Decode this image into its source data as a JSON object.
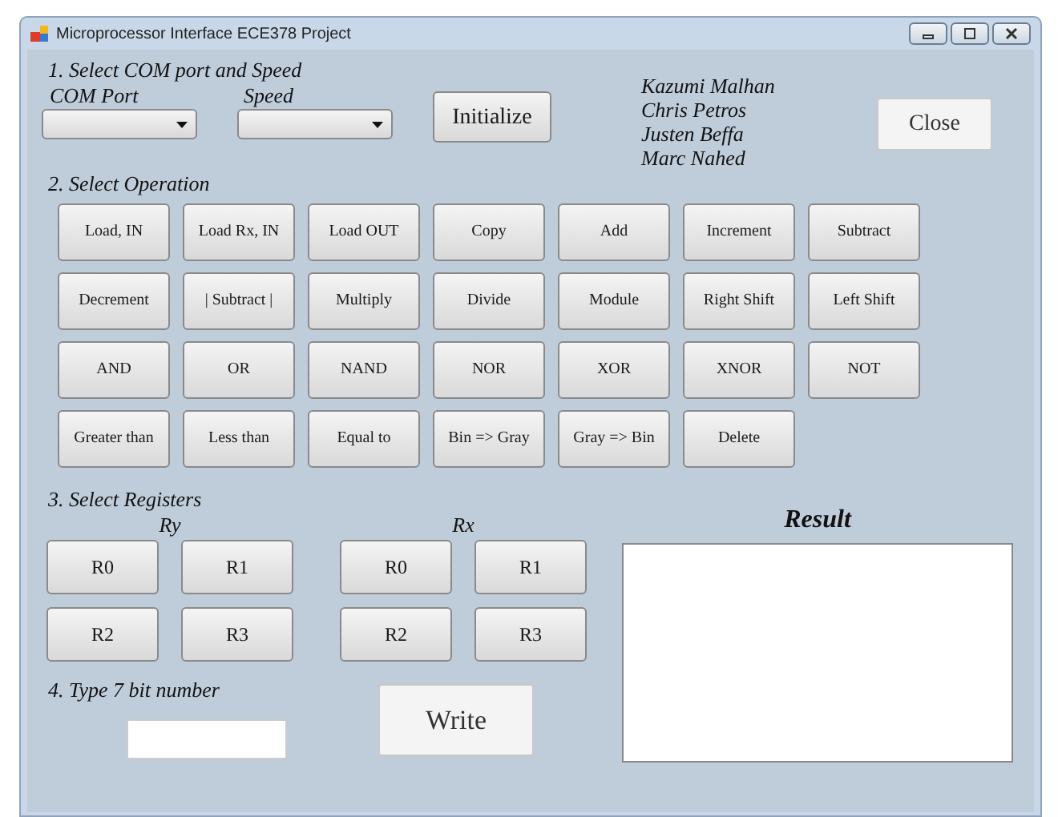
{
  "window": {
    "title": "Microprocessor Interface ECE378 Project"
  },
  "section_1": {
    "heading": "1. Select COM port and Speed",
    "com_port": {
      "label": "COM Port"
    },
    "speed": {
      "label": "Speed"
    },
    "initialize_button": "Initialize"
  },
  "authors": [
    "Kazumi Malhan",
    "Chris Petros",
    "Justen Beffa",
    "Marc Nahed"
  ],
  "close_button": "Close",
  "section_2": {
    "heading": "2. Select Operation",
    "operations": [
      "Load, IN",
      "Load Rx, IN",
      "Load OUT",
      "Copy",
      "Add",
      "Increment",
      "Subtract",
      "Decrement",
      "| Subtract |",
      "Multiply",
      "Divide",
      "Module",
      "Right Shift",
      "Left Shift",
      "AND",
      "OR",
      "NAND",
      "NOR",
      "XOR",
      "XNOR",
      "NOT",
      "Greater than",
      "Less than",
      "Equal to",
      "Bin => Gray",
      "Gray => Bin",
      "Delete"
    ]
  },
  "section_3": {
    "heading": "3. Select Registers",
    "groups": [
      {
        "label": "Ry",
        "registers": [
          "R0",
          "R1",
          "R2",
          "R3"
        ]
      },
      {
        "label": "Rx",
        "registers": [
          "R0",
          "R1",
          "R2",
          "R3"
        ]
      }
    ]
  },
  "section_4": {
    "heading": "4. Type 7 bit number",
    "write_button": "Write"
  },
  "result": {
    "title": "Result"
  }
}
